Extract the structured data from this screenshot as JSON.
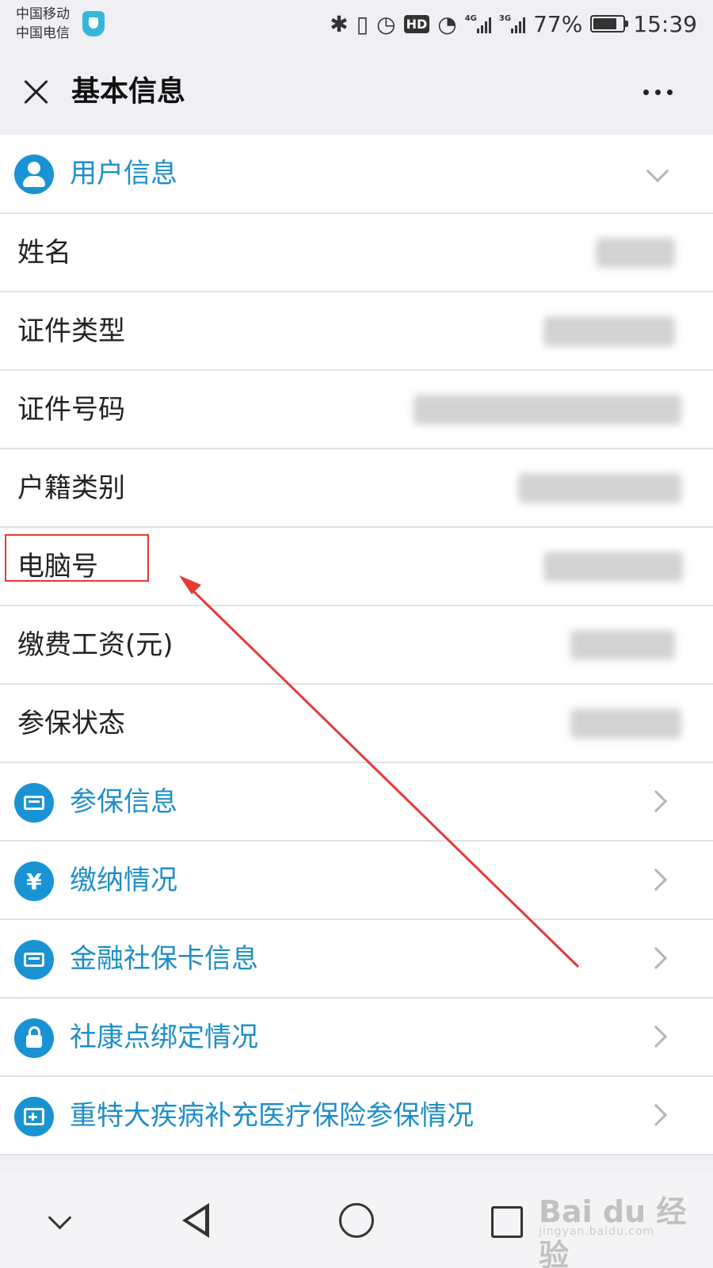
{
  "status_bar": {
    "carrier_1": "中国移动",
    "carrier_2": "中国电信",
    "net_4g": "4G",
    "net_3g": "3G",
    "battery_percent": "77%",
    "time": "15:39",
    "hd_label": "HD"
  },
  "header": {
    "title": "基本信息"
  },
  "user_section": {
    "title": "用户信息",
    "fields": [
      {
        "label": "姓名"
      },
      {
        "label": "证件类型"
      },
      {
        "label": "证件号码"
      },
      {
        "label": "户籍类别"
      },
      {
        "label": "电脑号"
      },
      {
        "label": "缴费工资(元)"
      },
      {
        "label": "参保状态"
      }
    ]
  },
  "links": [
    {
      "label": "参保信息",
      "icon": "id-card-icon"
    },
    {
      "label": "缴纳情况",
      "icon": "yen-icon"
    },
    {
      "label": "金融社保卡信息",
      "icon": "card-icon"
    },
    {
      "label": "社康点绑定情况",
      "icon": "lock-icon"
    },
    {
      "label": "重特大疾病补充医疗保险参保情况",
      "icon": "medical-plus-icon"
    }
  ],
  "watermark": {
    "text": "Bai du 经验",
    "sub": "jingyan.baidu.com"
  },
  "colors": {
    "accent": "#1a93d5",
    "link_text": "#1f8ec7",
    "annotation": "#e53935",
    "background": "#efeff4"
  }
}
